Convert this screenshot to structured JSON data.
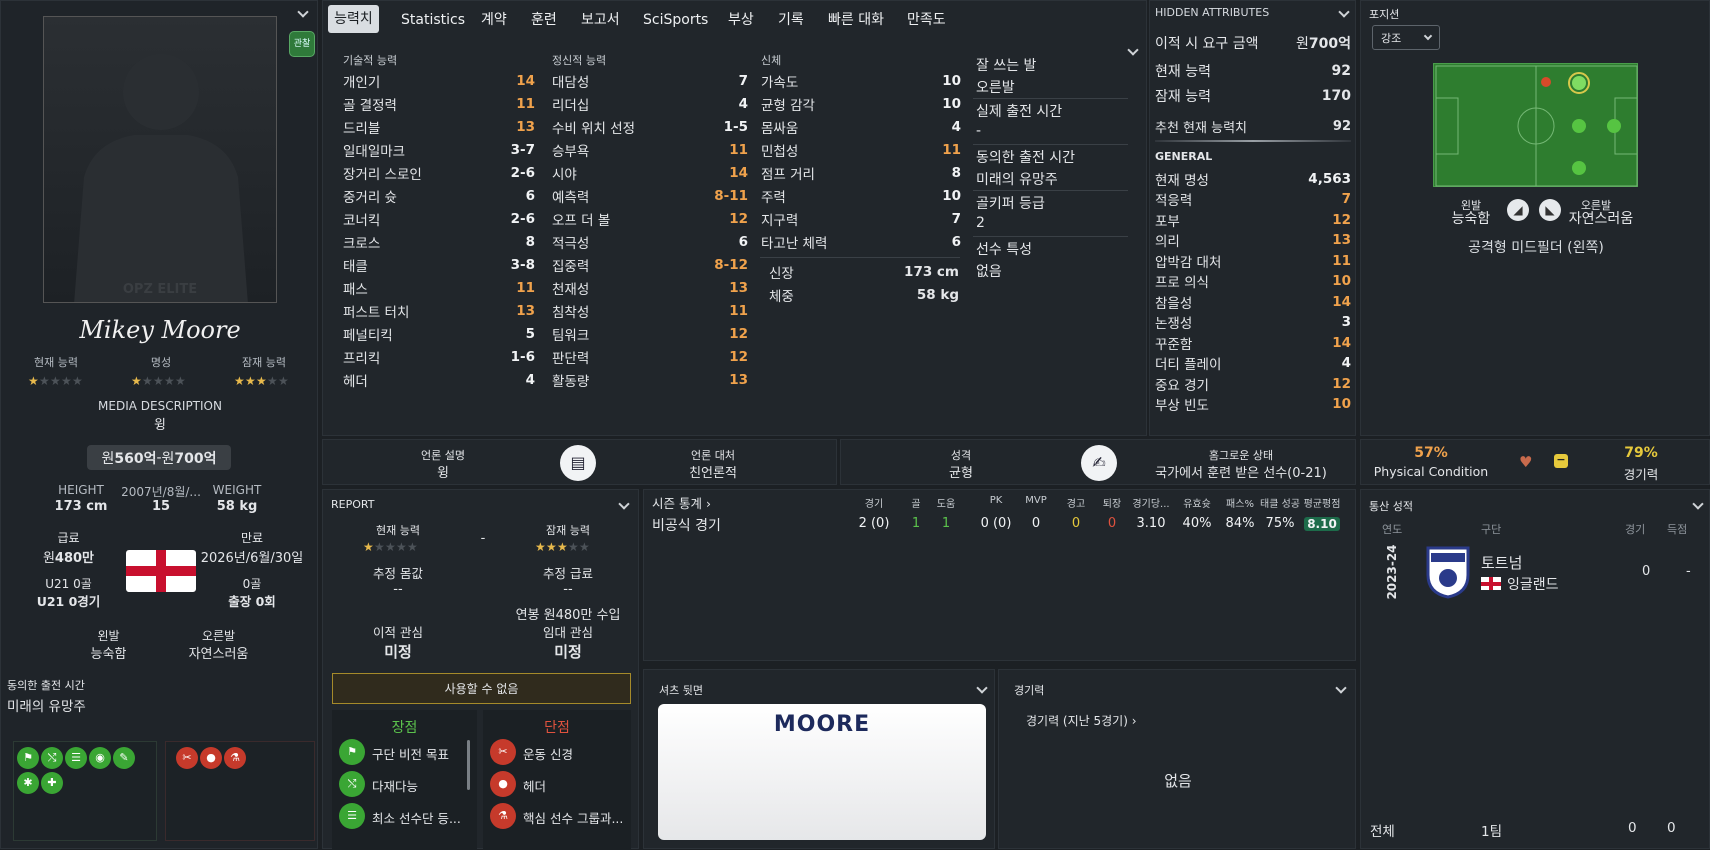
{
  "player": {
    "name": "Mikey Moore",
    "silhouette_text": "OPZ ELITE",
    "watch_label": "관찰",
    "labels": {
      "current_ability": "현재 능력",
      "reputation": "명성",
      "potential": "잠재 능력"
    },
    "ratings": {
      "current_ability_stars": 1,
      "reputation_stars": 1,
      "potential_stars": 3
    },
    "media_description_label": "MEDIA DESCRIPTION",
    "media_description": "윙",
    "value_range": {
      "prefix1": "원",
      "val1": "560억",
      "sep": " - ",
      "prefix2": "원",
      "val2": "700억"
    },
    "height_label": "HEIGHT",
    "height": "173 cm",
    "dob_label": "2007년/8월/...",
    "age": "15",
    "weight_label": "WEIGHT",
    "weight": "58 kg",
    "wage_label": "급료",
    "wage_prefix": "원",
    "wage": "480만",
    "expiry_label": "만료",
    "expiry": "2026년/6월/30일",
    "u21_goals_label": "U21 0골",
    "u21_apps": "U21 0경기",
    "goals_label": "0골",
    "apps": "출장 0회",
    "left_foot_label": "왼발",
    "left_foot": "능숙함",
    "right_foot_label": "오른발",
    "right_foot": "자연스러움",
    "agreed_time_label": "동의한 출전 시간",
    "agreed_time": "미래의 유망주"
  },
  "tabs": [
    "능력치",
    "Statistics",
    "계약",
    "훈련",
    "보고서",
    "SciSports",
    "부상",
    "기록",
    "빠른 대화",
    "만족도"
  ],
  "attributes": {
    "technical_title": "기술적 능력",
    "technical": [
      {
        "name": "개인기",
        "value": "14",
        "color": "#f0a24c"
      },
      {
        "name": "골 결정력",
        "value": "11",
        "color": "#f0a24c"
      },
      {
        "name": "드리블",
        "value": "13",
        "color": "#f0a24c"
      },
      {
        "name": "일대일마크",
        "value": "3-7",
        "color": "#f1f3f5"
      },
      {
        "name": "장거리 스로인",
        "value": "2-6",
        "color": "#f1f3f5"
      },
      {
        "name": "중거리 슛",
        "value": "6",
        "color": "#f1f3f5"
      },
      {
        "name": "코너킥",
        "value": "2-6",
        "color": "#f1f3f5"
      },
      {
        "name": "크로스",
        "value": "8",
        "color": "#f1f3f5"
      },
      {
        "name": "태클",
        "value": "3-8",
        "color": "#f1f3f5"
      },
      {
        "name": "패스",
        "value": "11",
        "color": "#f0a24c"
      },
      {
        "name": "퍼스트 터치",
        "value": "13",
        "color": "#f0a24c"
      },
      {
        "name": "페널티킥",
        "value": "5",
        "color": "#f1f3f5"
      },
      {
        "name": "프리킥",
        "value": "1-6",
        "color": "#f1f3f5"
      },
      {
        "name": "헤더",
        "value": "4",
        "color": "#f1f3f5"
      }
    ],
    "mental_title": "정신적 능력",
    "mental": [
      {
        "name": "대담성",
        "value": "7",
        "color": "#f1f3f5"
      },
      {
        "name": "리더십",
        "value": "4",
        "color": "#f1f3f5"
      },
      {
        "name": "수비 위치 선정",
        "value": "1-5",
        "color": "#f1f3f5"
      },
      {
        "name": "승부욕",
        "value": "11",
        "color": "#f0a24c"
      },
      {
        "name": "시야",
        "value": "14",
        "color": "#f0a24c"
      },
      {
        "name": "예측력",
        "value": "8-11",
        "color": "#f0a24c"
      },
      {
        "name": "오프 더 볼",
        "value": "12",
        "color": "#f0a24c"
      },
      {
        "name": "적극성",
        "value": "6",
        "color": "#f1f3f5"
      },
      {
        "name": "집중력",
        "value": "8-12",
        "color": "#f0a24c"
      },
      {
        "name": "천재성",
        "value": "13",
        "color": "#f0a24c"
      },
      {
        "name": "침착성",
        "value": "11",
        "color": "#f0a24c"
      },
      {
        "name": "팀워크",
        "value": "12",
        "color": "#f0a24c"
      },
      {
        "name": "판단력",
        "value": "12",
        "color": "#f0a24c"
      },
      {
        "name": "활동량",
        "value": "13",
        "color": "#f0a24c"
      }
    ],
    "physical_title": "신체",
    "physical": [
      {
        "name": "가속도",
        "value": "10",
        "color": "#f1f3f5"
      },
      {
        "name": "균형 감각",
        "value": "10",
        "color": "#f1f3f5"
      },
      {
        "name": "몸싸움",
        "value": "4",
        "color": "#f1f3f5"
      },
      {
        "name": "민첩성",
        "value": "11",
        "color": "#f0a24c"
      },
      {
        "name": "점프 거리",
        "value": "8",
        "color": "#f1f3f5"
      },
      {
        "name": "주력",
        "value": "10",
        "color": "#f1f3f5"
      },
      {
        "name": "지구력",
        "value": "7",
        "color": "#f1f3f5"
      },
      {
        "name": "타고난 체력",
        "value": "6",
        "color": "#f1f3f5"
      }
    ],
    "height_label": "신장",
    "height": "173 cm",
    "weight_label": "체중",
    "weight": "58 kg"
  },
  "info": [
    {
      "label": "잘 쓰는 발",
      "value": "오른발"
    },
    {
      "label": "실제 출전 시간",
      "value": "-"
    },
    {
      "label": "동의한 출전 시간",
      "value": "미래의 유망주"
    },
    {
      "label": "골키퍼 등급",
      "value": "2"
    },
    {
      "label": "선수 특성",
      "value": "없음"
    }
  ],
  "hidden": {
    "title": "HIDDEN ATTRIBUTES",
    "transfer_label": "이적 시 요구 금액",
    "transfer_prefix": "원",
    "transfer_value": "700억",
    "current_label": "현재 능력",
    "current_value": "92",
    "potential_label": "잠재 능력",
    "potential_value": "170",
    "recommended_label": "추천 현재 능력치",
    "recommended_value": "92",
    "general_title": "GENERAL",
    "general": [
      {
        "name": "현재 명성",
        "value": "4,563",
        "color": "#f1f3f5"
      },
      {
        "name": "적응력",
        "value": "7",
        "color": "#f0a24c"
      },
      {
        "name": "포부",
        "value": "12",
        "color": "#f0a24c"
      },
      {
        "name": "의리",
        "value": "13",
        "color": "#f0a24c"
      },
      {
        "name": "압박감 대처",
        "value": "11",
        "color": "#f0a24c"
      },
      {
        "name": "프로 의식",
        "value": "10",
        "color": "#f0a24c"
      },
      {
        "name": "참을성",
        "value": "14",
        "color": "#f0a24c"
      },
      {
        "name": "논쟁성",
        "value": "3",
        "color": "#f1f3f5"
      },
      {
        "name": "꾸준함",
        "value": "14",
        "color": "#f0a24c"
      },
      {
        "name": "더티 플레이",
        "value": "4",
        "color": "#f1f3f5"
      },
      {
        "name": "중요 경기",
        "value": "12",
        "color": "#f0a24c"
      },
      {
        "name": "부상 빈도",
        "value": "10",
        "color": "#f0a24c"
      }
    ]
  },
  "position": {
    "title": "포지션",
    "highlight": "강조",
    "left_foot_label": "왼발",
    "left_foot": "능숙함",
    "right_foot_label": "오른발",
    "right_foot": "자연스러움",
    "role": "공격형 미드필더 (왼쪽)"
  },
  "media_bar": {
    "media_label": "언론 설명",
    "media_value": "윙",
    "handling_label": "언론 대처",
    "handling_value": "친언론적",
    "personality_label": "성격",
    "personality_value": "균형",
    "status_label": "홈그로운 상태",
    "status_value": "국가에서 훈련 받은 선수(0-21)"
  },
  "condition": {
    "physical_pct": "57%",
    "physical_label": "Physical Condition",
    "sharpness_pct": "79%",
    "sharpness_label": "경기력"
  },
  "report": {
    "title": "REPORT",
    "current_label": "현재 능력",
    "potential_label": "잠재 능력",
    "current_stars": 1,
    "potential_stars": 3,
    "dash": "-",
    "fee_label": "추정 몸값",
    "fee_value": "--",
    "wage_label": "추정 급료",
    "wage_value": "--",
    "wage_note": "연봉 원480만 수입",
    "transfer_interest_label": "이적 관심",
    "transfer_interest": "미정",
    "loan_interest_label": "임대 관심",
    "loan_interest": "미정",
    "unavailable": "사용할 수 없음",
    "strengths_title": "장점",
    "strengths": [
      "구단 비전 목표",
      "다재다능",
      "최소 선수단 등..."
    ],
    "weaknesses_title": "단점",
    "weaknesses": [
      "운동 신경",
      "헤더",
      "핵심 선수 그룹과..."
    ]
  },
  "season": {
    "title": "시즌 통계",
    "headers": [
      "경기",
      "골",
      "도움",
      "PK",
      "MVP",
      "경고",
      "퇴장",
      "경기당...",
      "유효슛",
      "패스%",
      "태클 성공",
      "평균평점"
    ],
    "row_label": "비공식 경기",
    "row": [
      "2 (0)",
      "1",
      "1",
      "0 (0)",
      "0",
      "0",
      "0",
      "3.10",
      "40%",
      "84%",
      "75%",
      "8.10"
    ]
  },
  "career": {
    "title": "통산 성적",
    "headers": [
      "연도",
      "구단",
      "경기",
      "득점"
    ],
    "year": "2023-24",
    "club": "토트넘",
    "nation": "잉글랜드",
    "apps": "0",
    "goals": "-",
    "total_label": "전체",
    "total_team": "1팀",
    "total_apps": "0",
    "total_goals": "0"
  },
  "shirt": {
    "title": "셔츠 뒷면",
    "name": "MOORE"
  },
  "form": {
    "title": "경기력",
    "subtitle": "경기력 (지난 5경기)",
    "empty": "없음"
  }
}
